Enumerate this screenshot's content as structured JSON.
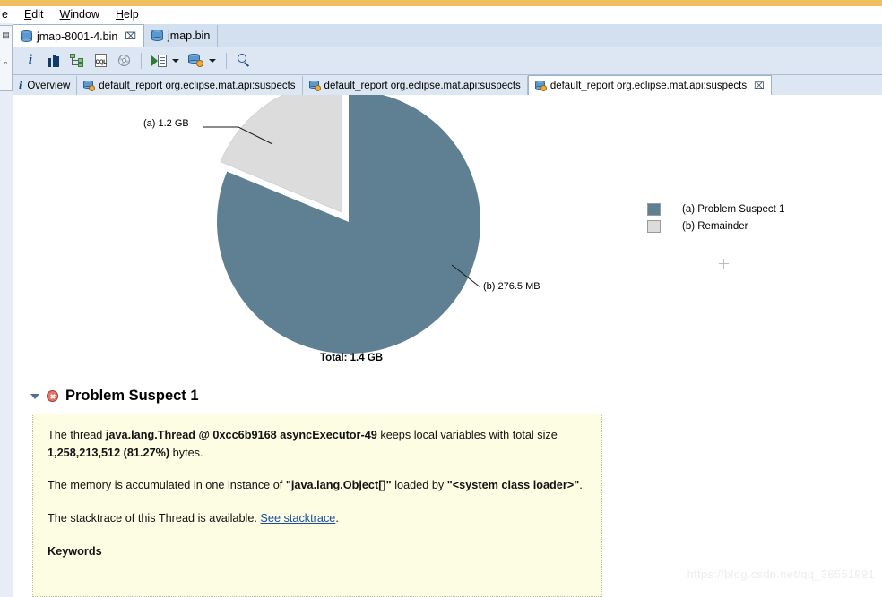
{
  "window": {
    "title_strip_ghost": "",
    "menu": [
      {
        "label": "e",
        "mnemonic": ""
      },
      {
        "label": "Edit",
        "mnemonic": "E"
      },
      {
        "label": "Window",
        "mnemonic": "W"
      },
      {
        "label": "Help",
        "mnemonic": "H"
      }
    ]
  },
  "editor_tabs": [
    {
      "label": "jmap-8001-4.bin",
      "icon": "heap-dump-icon",
      "active": true,
      "close": "⌧"
    },
    {
      "label": "jmap.bin",
      "icon": "heap-dump-icon",
      "active": false,
      "close": ""
    }
  ],
  "toolbar": {
    "buttons": [
      {
        "name": "overview-info-button",
        "icon": "info-icon",
        "glyph": "i"
      },
      {
        "name": "histogram-button",
        "icon": "bar-chart-icon"
      },
      {
        "name": "dominator-tree-button",
        "icon": "tree-icon"
      },
      {
        "name": "oql-button",
        "icon": "oql-document-icon",
        "glyph": "OQL"
      },
      {
        "name": "query-browser-button",
        "icon": "gear-icon"
      },
      {
        "name": "run-expert-system-button",
        "icon": "run-report-icon"
      },
      {
        "name": "open-report-button",
        "icon": "report-cylinder-icon"
      },
      {
        "name": "search-button",
        "icon": "search-icon"
      }
    ]
  },
  "inner_tabs": [
    {
      "label": "Overview",
      "icon": "info-icon",
      "active": false,
      "closeable": false
    },
    {
      "label": "default_report  org.eclipse.mat.api:suspects",
      "icon": "report-icon",
      "active": false,
      "closeable": false
    },
    {
      "label": "default_report  org.eclipse.mat.api:suspects",
      "icon": "report-icon",
      "active": false,
      "closeable": false
    },
    {
      "label": "default_report  org.eclipse.mat.api:suspects",
      "icon": "report-icon",
      "active": true,
      "closeable": true,
      "close": "⌧"
    }
  ],
  "chart_data": {
    "type": "pie",
    "title": "",
    "total_label": "Total: 1.4 GB",
    "categories": [
      "(a) Problem Suspect 1",
      "(b) Remainder"
    ],
    "values": [
      81.27,
      18.73
    ],
    "value_labels": [
      "1.2 GB",
      "276.5 MB"
    ],
    "point_labels": [
      "(a)  1.2 GB",
      "(b)  276.5 MB"
    ],
    "colors": [
      "#5f8092",
      "#dcdcdc"
    ],
    "exploded": [
      false,
      true
    ],
    "legend_position": "right",
    "legend": [
      {
        "marker": "(a)",
        "label": "(a)  Problem Suspect 1",
        "color": "#5f8092"
      },
      {
        "marker": "(b)",
        "label": "(b)  Remainder",
        "color": "#dcdcdc"
      }
    ]
  },
  "suspect": {
    "title": "Problem Suspect 1",
    "status_icon": "error-icon",
    "collapsed": false,
    "paragraph1": {
      "pre": "The thread ",
      "bold1": "java.lang.Thread @ 0xcc6b9168 asyncExecutor-49",
      "mid": " keeps local variables with total size ",
      "bold2": "1,258,213,512 (81.27%)",
      "post": " bytes."
    },
    "paragraph2": {
      "pre": "The memory is accumulated in one instance of ",
      "bold1": "\"java.lang.Object[]\"",
      "mid": " loaded by ",
      "bold2": "\"<system class loader>\"",
      "post": "."
    },
    "paragraph3": {
      "pre": "The stacktrace of this Thread is available. ",
      "link": "See stacktrace",
      "post": "."
    },
    "keywords_heading": "Keywords"
  },
  "watermark": "https://blog.csdn.net/qq_36551991"
}
